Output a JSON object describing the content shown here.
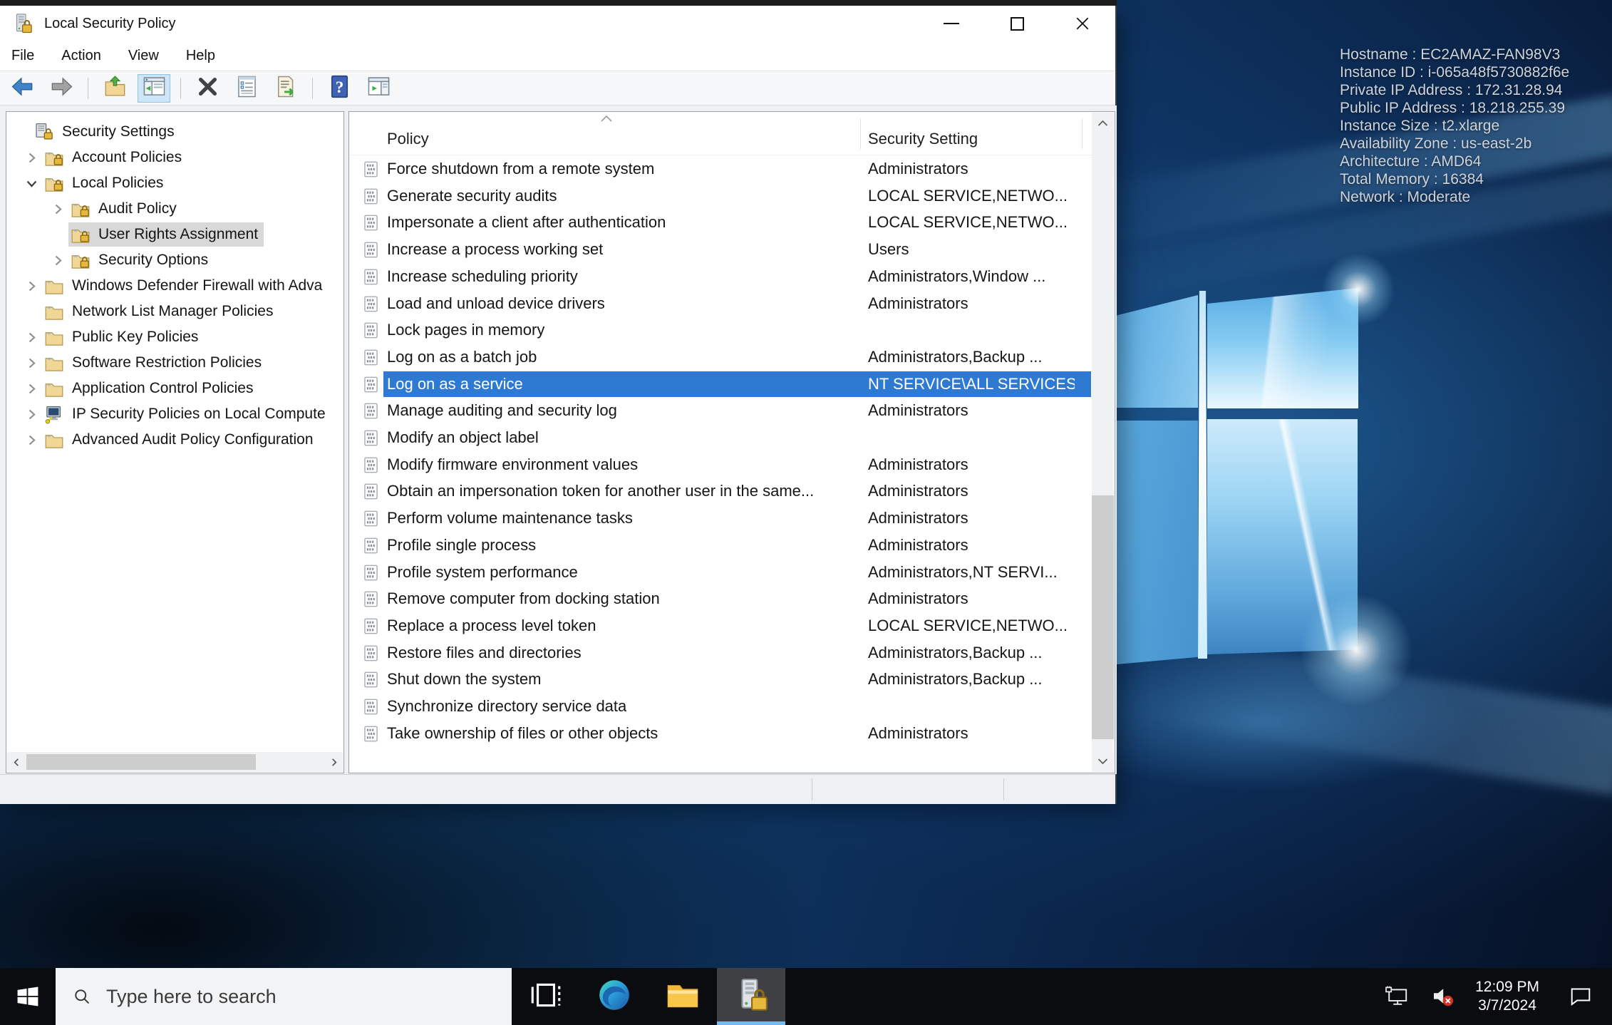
{
  "window": {
    "title": "Local Security Policy",
    "menu": [
      "File",
      "Action",
      "View",
      "Help"
    ],
    "toolbar": [
      {
        "name": "back-button",
        "icon": "back-icon"
      },
      {
        "name": "forward-button",
        "icon": "forward-icon"
      },
      {
        "separator": true
      },
      {
        "name": "up-level-button",
        "icon": "up-folder-icon"
      },
      {
        "name": "show-console-tree-button",
        "icon": "console-tree-icon",
        "active": true
      },
      {
        "separator": true
      },
      {
        "name": "delete-button",
        "icon": "delete-icon"
      },
      {
        "name": "properties-button",
        "icon": "properties-icon"
      },
      {
        "name": "export-list-button",
        "icon": "export-list-icon"
      },
      {
        "separator": true
      },
      {
        "name": "help-button",
        "icon": "help-icon"
      },
      {
        "name": "show-action-pane-button",
        "icon": "action-pane-icon"
      }
    ],
    "tree": [
      {
        "label": "Security Settings",
        "level": 0,
        "expander": "",
        "icon": "computer-lock-icon",
        "selected": false
      },
      {
        "label": "Account Policies",
        "level": 1,
        "expander": "collapsed",
        "icon": "folder-lock-icon",
        "selected": false
      },
      {
        "label": "Local Policies",
        "level": 1,
        "expander": "expanded",
        "icon": "folder-lock-icon",
        "selected": false
      },
      {
        "label": "Audit Policy",
        "level": 2,
        "expander": "collapsed",
        "icon": "folder-lock-icon",
        "selected": false
      },
      {
        "label": "User Rights Assignment",
        "level": 2,
        "expander": "",
        "icon": "folder-lock-icon",
        "selected": true
      },
      {
        "label": "Security Options",
        "level": 2,
        "expander": "collapsed",
        "icon": "folder-lock-icon",
        "selected": false
      },
      {
        "label": "Windows Defender Firewall with Adva",
        "level": 1,
        "expander": "collapsed",
        "icon": "folder-icon",
        "selected": false
      },
      {
        "label": "Network List Manager Policies",
        "level": 1,
        "expander": "",
        "icon": "folder-icon",
        "selected": false
      },
      {
        "label": "Public Key Policies",
        "level": 1,
        "expander": "collapsed",
        "icon": "folder-icon",
        "selected": false
      },
      {
        "label": "Software Restriction Policies",
        "level": 1,
        "expander": "collapsed",
        "icon": "folder-icon",
        "selected": false
      },
      {
        "label": "Application Control Policies",
        "level": 1,
        "expander": "collapsed",
        "icon": "folder-icon",
        "selected": false
      },
      {
        "label": "IP Security Policies on Local Compute",
        "level": 1,
        "expander": "collapsed",
        "icon": "computer-key-icon",
        "selected": false
      },
      {
        "label": "Advanced Audit Policy Configuration",
        "level": 1,
        "expander": "collapsed",
        "icon": "folder-icon",
        "selected": false
      }
    ],
    "list": {
      "columns": [
        "Policy",
        "Security Setting"
      ],
      "sort": "asc",
      "rows": [
        {
          "policy": "Force shutdown from a remote system",
          "setting": "Administrators",
          "selected": false
        },
        {
          "policy": "Generate security audits",
          "setting": "LOCAL SERVICE,NETWO...",
          "selected": false
        },
        {
          "policy": "Impersonate a client after authentication",
          "setting": "LOCAL SERVICE,NETWO...",
          "selected": false
        },
        {
          "policy": "Increase a process working set",
          "setting": "Users",
          "selected": false
        },
        {
          "policy": "Increase scheduling priority",
          "setting": "Administrators,Window ...",
          "selected": false
        },
        {
          "policy": "Load and unload device drivers",
          "setting": "Administrators",
          "selected": false
        },
        {
          "policy": "Lock pages in memory",
          "setting": "",
          "selected": false
        },
        {
          "policy": "Log on as a batch job",
          "setting": "Administrators,Backup ...",
          "selected": false
        },
        {
          "policy": "Log on as a service",
          "setting": "NT SERVICE\\ALL SERVICES",
          "selected": true
        },
        {
          "policy": "Manage auditing and security log",
          "setting": "Administrators",
          "selected": false
        },
        {
          "policy": "Modify an object label",
          "setting": "",
          "selected": false
        },
        {
          "policy": "Modify firmware environment values",
          "setting": "Administrators",
          "selected": false
        },
        {
          "policy": "Obtain an impersonation token for another user in the same...",
          "setting": "Administrators",
          "selected": false
        },
        {
          "policy": "Perform volume maintenance tasks",
          "setting": "Administrators",
          "selected": false
        },
        {
          "policy": "Profile single process",
          "setting": "Administrators",
          "selected": false
        },
        {
          "policy": "Profile system performance",
          "setting": "Administrators,NT SERVI...",
          "selected": false
        },
        {
          "policy": "Remove computer from docking station",
          "setting": "Administrators",
          "selected": false
        },
        {
          "policy": "Replace a process level token",
          "setting": "LOCAL SERVICE,NETWO...",
          "selected": false
        },
        {
          "policy": "Restore files and directories",
          "setting": "Administrators,Backup ...",
          "selected": false
        },
        {
          "policy": "Shut down the system",
          "setting": "Administrators,Backup ...",
          "selected": false
        },
        {
          "policy": "Synchronize directory service data",
          "setting": "",
          "selected": false
        },
        {
          "policy": "Take ownership of files or other objects",
          "setting": "Administrators",
          "selected": false
        }
      ]
    }
  },
  "desktop": {
    "instance_info": [
      "Hostname : EC2AMAZ-FAN98V3",
      "Instance ID : i-065a48f5730882f6e",
      "Private IP Address : 172.31.28.94",
      "Public IP Address : 18.218.255.39",
      "Instance Size : t2.xlarge",
      "Availability Zone : us-east-2b",
      "Architecture : AMD64",
      "Total Memory : 16384",
      "Network : Moderate"
    ]
  },
  "taskbar": {
    "search": {
      "placeholder": "Type here to search",
      "icon": "search-icon"
    },
    "apps": [
      {
        "name": "task-view-button",
        "icon": "task-view-icon",
        "active": false
      },
      {
        "name": "edge-button",
        "icon": "edge-icon",
        "active": false
      },
      {
        "name": "file-explorer-button",
        "icon": "file-explorer-icon",
        "active": false
      },
      {
        "name": "local-security-policy-button",
        "icon": "security-policy-icon",
        "active": true
      }
    ],
    "tray_icons": [
      "network-icon",
      "volume-muted-icon"
    ],
    "clock": {
      "time": "12:09 PM",
      "date": "3/7/2024"
    },
    "action_center_icon": "action-center-icon"
  },
  "colors": {
    "selection_blue": "#2e7ad2",
    "tree_selection_gray": "#d8d8d8",
    "taskbar_accent": "#76b9ed",
    "desktop_navy": "#0c2c55"
  }
}
